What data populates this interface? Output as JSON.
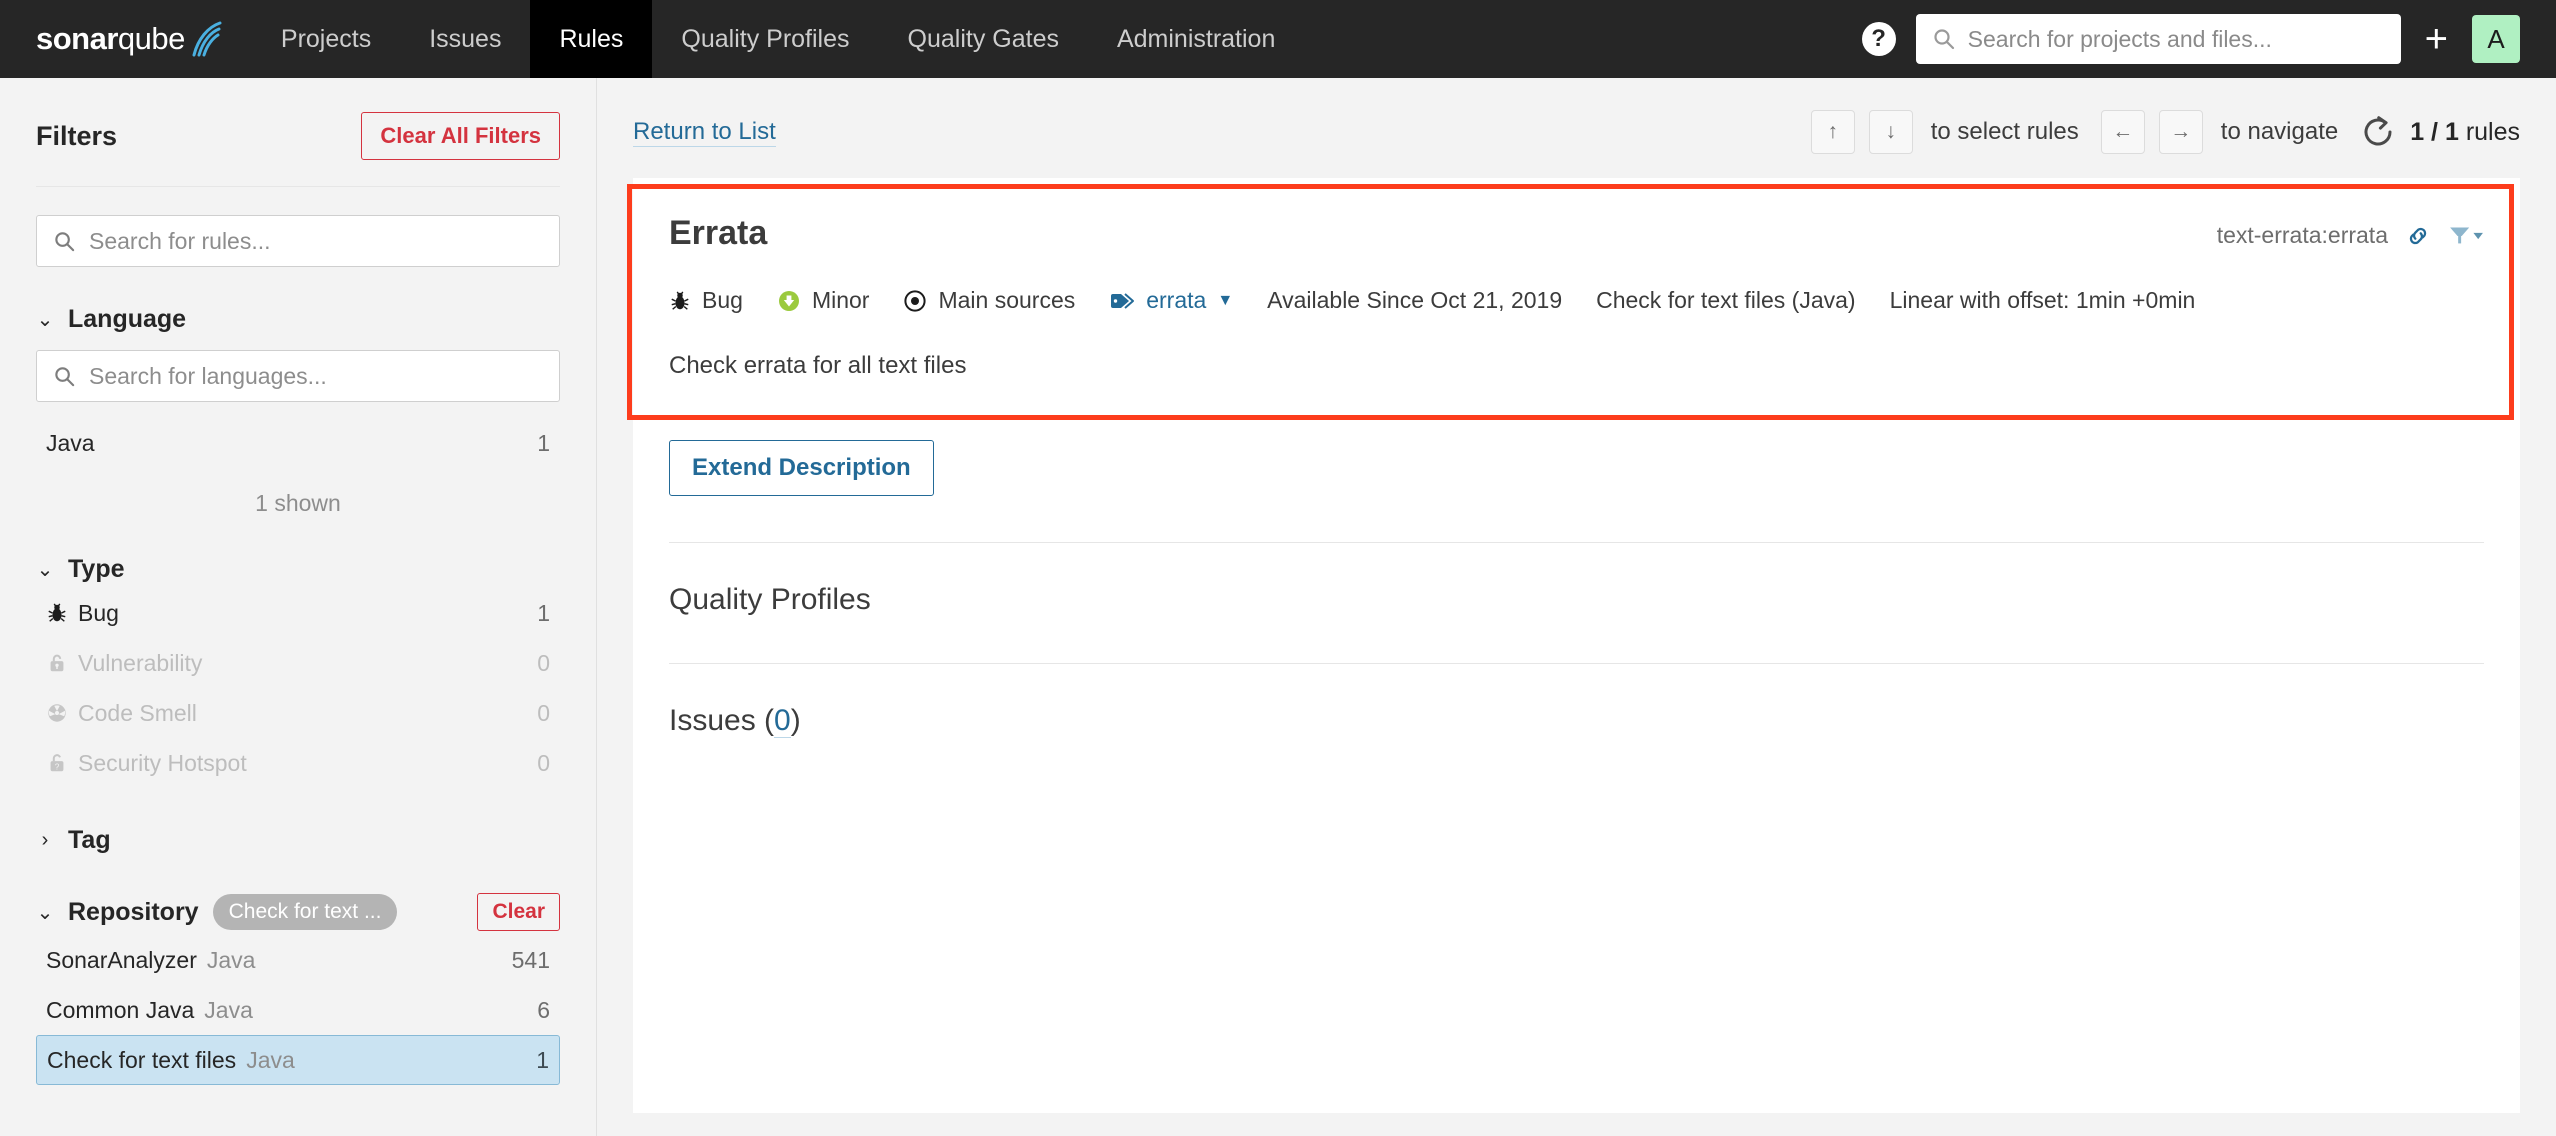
{
  "topnav": {
    "brand_bold": "sonar",
    "brand_light": "qube",
    "items": [
      {
        "label": "Projects",
        "active": false
      },
      {
        "label": "Issues",
        "active": false
      },
      {
        "label": "Rules",
        "active": true
      },
      {
        "label": "Quality Profiles",
        "active": false
      },
      {
        "label": "Quality Gates",
        "active": false
      },
      {
        "label": "Administration",
        "active": false
      }
    ],
    "help_glyph": "?",
    "search_placeholder": "Search for projects and files...",
    "plus_glyph": "+",
    "avatar_initial": "A",
    "avatar_color": "#b0f0c2"
  },
  "sidebar": {
    "title": "Filters",
    "clear_all_label": "Clear All Filters",
    "rules_search_placeholder": "Search for rules...",
    "language": {
      "title": "Language",
      "search_placeholder": "Search for languages...",
      "items": [
        {
          "name": "Java",
          "count": "1"
        }
      ],
      "shown_note": "1 shown"
    },
    "type": {
      "title": "Type",
      "items": [
        {
          "icon": "bug-icon",
          "name": "Bug",
          "count": "1",
          "disabled": false
        },
        {
          "icon": "vulnerability-icon",
          "name": "Vulnerability",
          "count": "0",
          "disabled": true
        },
        {
          "icon": "code-smell-icon",
          "name": "Code Smell",
          "count": "0",
          "disabled": true
        },
        {
          "icon": "security-hotspot-icon",
          "name": "Security Hotspot",
          "count": "0",
          "disabled": true
        }
      ]
    },
    "tag": {
      "title": "Tag"
    },
    "repository": {
      "title": "Repository",
      "pill_label": "Check for text ...",
      "clear_label": "Clear",
      "items": [
        {
          "name": "SonarAnalyzer",
          "lang": "Java",
          "count": "541",
          "selected": false
        },
        {
          "name": "Common Java",
          "lang": "Java",
          "count": "6",
          "selected": false
        },
        {
          "name": "Check for text files",
          "lang": "Java",
          "count": "1",
          "selected": true
        }
      ]
    }
  },
  "main": {
    "return_link": "Return to List",
    "hints": {
      "up_key": "↑",
      "down_key": "↓",
      "select_text": "to select rules",
      "left_key": "←",
      "right_key": "→",
      "navigate_text": "to navigate"
    },
    "rules_count": "1 / 1",
    "rules_unit": "rules",
    "rule": {
      "title": "Errata",
      "key": "text-errata:errata",
      "type": "Bug",
      "severity": "Minor",
      "scope": "Main sources",
      "tag": "errata",
      "available_since": "Available Since Oct 21, 2019",
      "repository": "Check for text files (Java)",
      "remediation": "Linear with offset: 1min +0min",
      "description": "Check errata for all text files",
      "extend_label": "Extend Description"
    },
    "quality_profiles_title": "Quality Profiles",
    "issues_title_prefix": "Issues (",
    "issues_count": "0",
    "issues_title_suffix": ")"
  },
  "colors": {
    "accent_red": "#d4333f",
    "highlight_red": "#fd3c1c",
    "link_blue": "#236a97",
    "minor_green": "#9bca3e",
    "selected_blue": "#cae3f2"
  }
}
